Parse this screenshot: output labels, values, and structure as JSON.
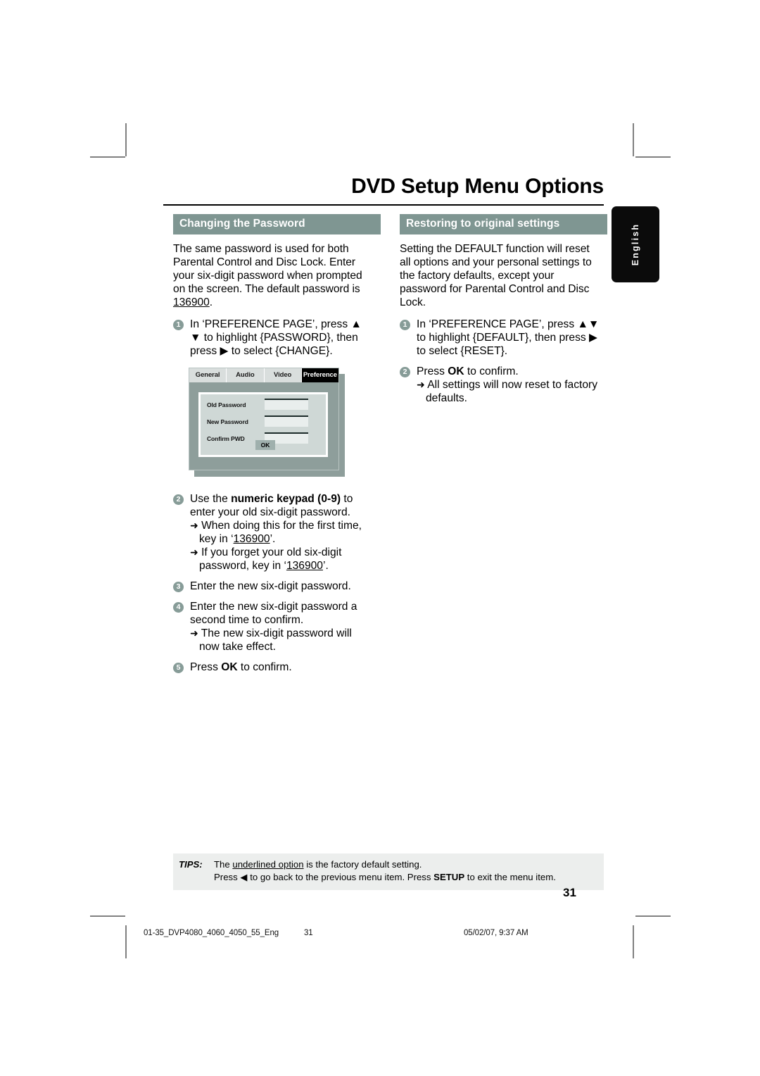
{
  "page": {
    "title": "DVD Setup Menu Options",
    "language_tab": "English",
    "page_number": "31"
  },
  "left_column": {
    "heading": "Changing the Password",
    "intro_1": "The same password is used for both Parental Control and Disc Lock.  Enter your six-digit password when prompted on the screen. The default password is ",
    "intro_default_password": "136900",
    "intro_1_end": ".",
    "steps": [
      {
        "num": "1",
        "text_a": "In ‘PREFERENCE PAGE’, press ",
        "icon_up": "▲",
        "icon_down": "▼",
        "text_b": " to highlight {PASSWORD}, then press ",
        "icon_right": "▶",
        "text_c": " to select {CHANGE}."
      },
      {
        "num": "2",
        "text_a": "Use the ",
        "bold": "numeric keypad (0-9)",
        "text_b": " to enter your old six-digit password.",
        "subs": [
          {
            "arrow": "➜",
            "text_a": " When doing this for the first time, key in ‘",
            "underline": "136900",
            "text_b": "’."
          },
          {
            "arrow": "➜",
            "text_a": " If you forget your old six-digit password, key in ‘",
            "underline": "136900",
            "text_b": "’."
          }
        ]
      },
      {
        "num": "3",
        "text_a": "Enter the new six-digit password."
      },
      {
        "num": "4",
        "text_a": "Enter the new six-digit password a second time to confirm.",
        "subs": [
          {
            "arrow": "➜",
            "text_a": " The new six-digit password will now take effect."
          }
        ]
      },
      {
        "num": "5",
        "text_a": "Press ",
        "bold": "OK",
        "text_b": " to confirm."
      }
    ],
    "osd": {
      "tabs": [
        {
          "label": "General",
          "active": false
        },
        {
          "label": "Audio",
          "active": false
        },
        {
          "label": "Video",
          "active": false
        },
        {
          "label": "Preference",
          "active": true
        }
      ],
      "fields": [
        {
          "label": "Old Password",
          "value": ""
        },
        {
          "label": "New Password",
          "value": ""
        },
        {
          "label": "Confirm PWD",
          "value": ""
        }
      ],
      "ok_button": "OK"
    }
  },
  "right_column": {
    "heading": "Restoring to original settings",
    "intro": "Setting the DEFAULT function will reset all options and your personal settings to the factory defaults, except your password for Parental Control and Disc Lock.",
    "steps": [
      {
        "num": "1",
        "text_a": "In ‘PREFERENCE PAGE’, press ",
        "icon_up": "▲",
        "icon_down": "▼",
        "text_b": " to highlight {DEFAULT}, then press ",
        "icon_right": "▶",
        "text_c": "  to select {RESET}."
      },
      {
        "num": "2",
        "text_a": "Press ",
        "bold": "OK",
        "text_b": " to confirm.",
        "subs": [
          {
            "arrow": "➜",
            "text_a": " All settings will now reset to factory defaults."
          }
        ]
      }
    ]
  },
  "tips": {
    "label": "TIPS:",
    "line1_a": "The ",
    "line1_underline": "underlined option",
    "line1_b": " is the factory default setting.",
    "line2_a": "Press ",
    "line2_icon": "◀",
    "line2_b": " to go back to the previous menu item. Press ",
    "line2_bold": "SETUP",
    "line2_c": " to exit the menu item."
  },
  "footer": {
    "file": "01-35_DVP4080_4060_4050_55_Eng",
    "page": "31",
    "date": "05/02/07, 9:37 AM"
  },
  "colors": {
    "accent": "#7f9692",
    "bullet": "#879c98",
    "tips_bg": "#eceeed",
    "osd_bg": "#8e9e9b"
  }
}
